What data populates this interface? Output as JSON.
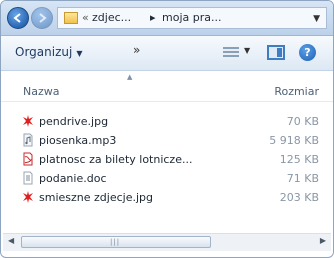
{
  "address_bar": {
    "path_prefix": "«",
    "crumbs": [
      "zdjec...",
      "moja pra..."
    ],
    "separator": "▸"
  },
  "toolbar": {
    "organize_label": "Organizuj",
    "more_label": "»",
    "help_label": "?"
  },
  "columns": {
    "name": "Nazwa",
    "size": "Rozmiar"
  },
  "files": [
    {
      "name": "pendrive.jpg",
      "size": "70 KB",
      "icon": "jpg-image-icon"
    },
    {
      "name": "piosenka.mp3",
      "size": "5 918 KB",
      "icon": "mp3-audio-icon"
    },
    {
      "name": "platnosc za bilety lotnicze...",
      "size": "125 KB",
      "icon": "pdf-document-icon"
    },
    {
      "name": "podanie.doc",
      "size": "71 KB",
      "icon": "doc-document-icon"
    },
    {
      "name": "smieszne zdjecje.jpg",
      "size": "203 KB",
      "icon": "jpg-image-icon"
    }
  ],
  "colors": {
    "accent": "#2a67b4",
    "jpg_icon": "#e02020",
    "pdf_icon": "#c62828"
  }
}
